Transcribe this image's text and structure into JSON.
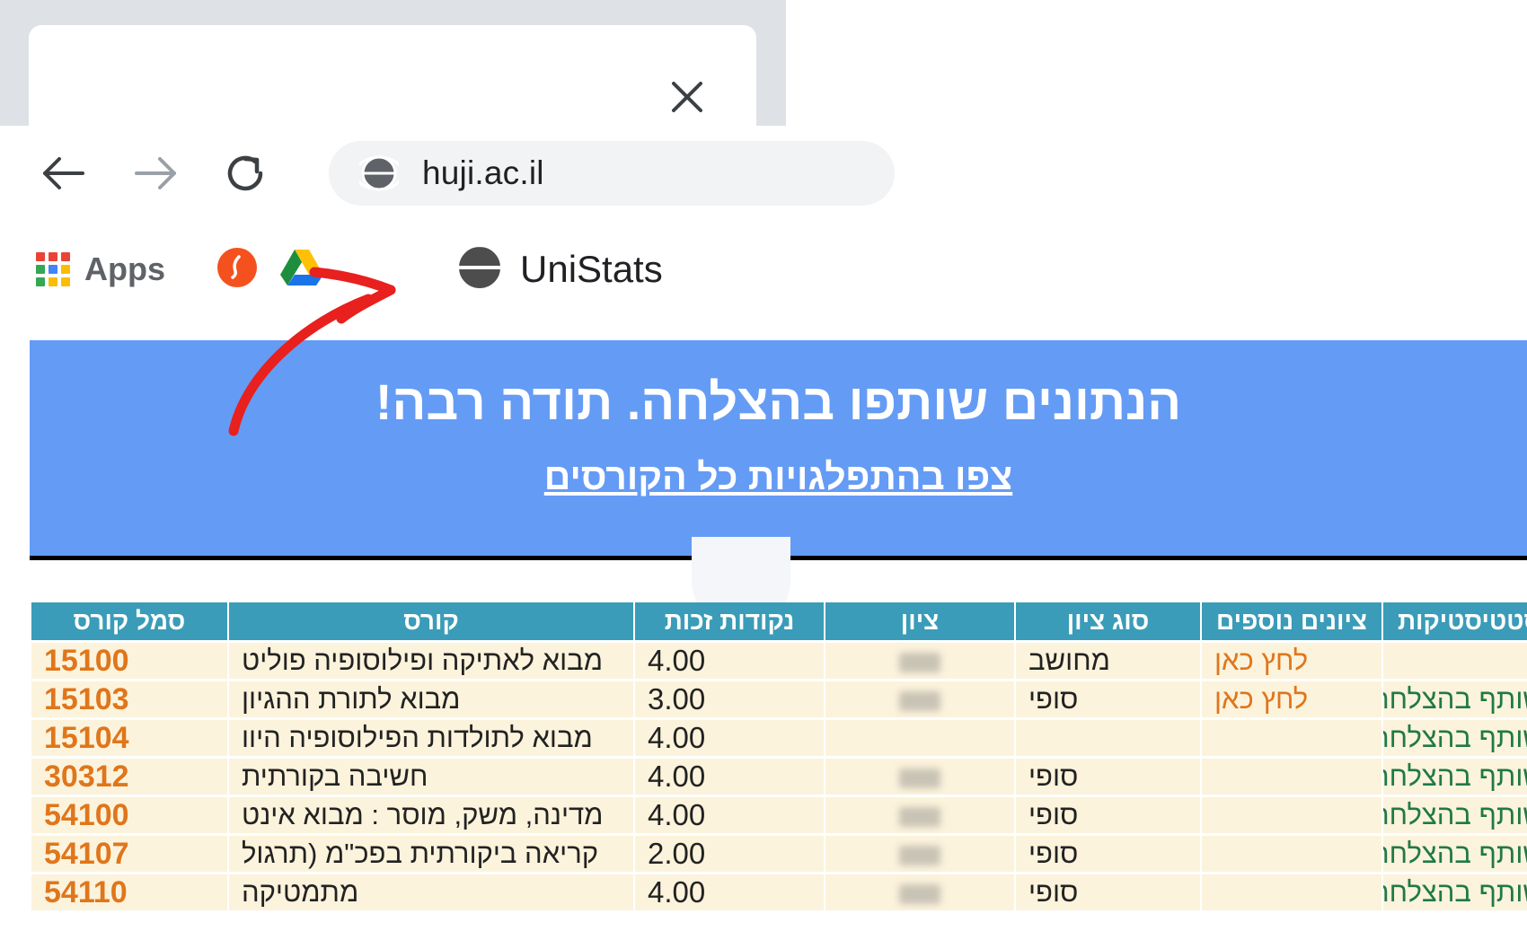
{
  "browser": {
    "url": "huji.ac.il",
    "tab_close_label": "×",
    "nav": {
      "back": "back-arrow",
      "forward": "forward-arrow",
      "reload": "reload-arrow"
    },
    "bookmarks": [
      {
        "label": "Apps",
        "icon": "apps-grid-icon"
      },
      {
        "label": "",
        "icon": "orange-circle-icon"
      },
      {
        "label": "",
        "icon": "google-drive-icon"
      },
      {
        "label": "UniStats",
        "icon": "globe-icon"
      }
    ]
  },
  "banner": {
    "title": "הנתונים שותפו בהצלחה. תודה רבה!",
    "link": "צפו בהתפלגויות כל הקורסים",
    "bg_color": "#649bf5"
  },
  "table": {
    "header_color": "#3a9cb8",
    "row_color": "#fcf3dc",
    "columns": [
      "סמל קורס",
      "קורס",
      "נקודות זכות",
      "ציון",
      "סוג ציון",
      "ציונים נוספים",
      "סטטיסטיקות"
    ],
    "rows": [
      {
        "code": "15100",
        "course": "מבוא לאתיקה ופילוסופיה פוליט",
        "credits": "4.00",
        "grade": "",
        "grade_type": "מחושב",
        "extra_grades": "לחץ כאן",
        "stats": ""
      },
      {
        "code": "15103",
        "course": "מבוא לתורת ההגיון",
        "credits": "3.00",
        "grade": "",
        "grade_type": "סופי",
        "extra_grades": "לחץ כאן",
        "stats": "שותף בהצלחה!"
      },
      {
        "code": "15104",
        "course": "מבוא לתולדות הפילוסופיה היוו",
        "credits": "4.00",
        "grade": "",
        "grade_type": "",
        "extra_grades": "",
        "stats": "שותף בהצלחה!"
      },
      {
        "code": "30312",
        "course": "חשיבה בקורתית",
        "credits": "4.00",
        "grade": "",
        "grade_type": "סופי",
        "extra_grades": "",
        "stats": "שותף בהצלחה!"
      },
      {
        "code": "54100",
        "course": "מדינה, משק, מוסר : מבוא אינט",
        "credits": "4.00",
        "grade": "",
        "grade_type": "סופי",
        "extra_grades": "",
        "stats": "שותף בהצלחה!"
      },
      {
        "code": "54107",
        "course": "קריאה ביקורתית בפכ\"מ (תרגול",
        "credits": "2.00",
        "grade": "",
        "grade_type": "סופי",
        "extra_grades": "",
        "stats": "שותף בהצלחה!"
      },
      {
        "code": "54110",
        "course": "מתמטיקה",
        "credits": "4.00",
        "grade": "",
        "grade_type": "סופי",
        "extra_grades": "",
        "stats": "שותף בהצלחה!"
      }
    ]
  },
  "annotation": {
    "type": "red-arrow",
    "color": "#e8201e",
    "points_to": "UniStats bookmark"
  }
}
